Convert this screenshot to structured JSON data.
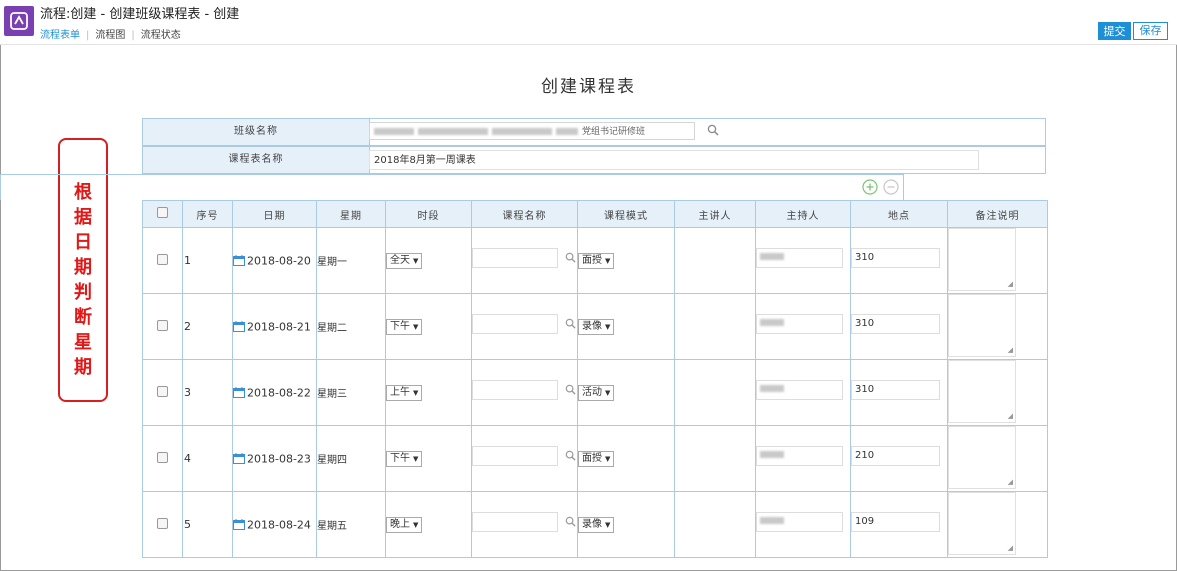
{
  "window_title": "流程:创建 - 创建班级课程表 - 创建",
  "tabs": [
    {
      "label": "流程表单",
      "active": true
    },
    {
      "label": "流程图",
      "active": false
    },
    {
      "label": "流程状态",
      "active": false
    }
  ],
  "actions": {
    "submit": "提交",
    "save": "保存"
  },
  "page_title": "创建课程表",
  "annotation": "根据日期判断星期",
  "form": {
    "class_name_label": "班级名称",
    "class_name_value": "党组书记研修班",
    "course_name_label": "课程表名称",
    "course_name_value": "2018年8月第一周课表"
  },
  "columns": [
    "",
    "序号",
    "日期",
    "星期",
    "时段",
    "课程名称",
    "课程模式",
    "主讲人",
    "主持人",
    "地点",
    "备注说明"
  ],
  "rows": [
    {
      "no": "1",
      "date": "2018-08-20",
      "weekday": "星期一",
      "period": "全天",
      "mode": "面授",
      "host": "",
      "place": "310"
    },
    {
      "no": "2",
      "date": "2018-08-21",
      "weekday": "星期二",
      "period": "下午",
      "mode": "录像",
      "host": "",
      "place": "310"
    },
    {
      "no": "3",
      "date": "2018-08-22",
      "weekday": "星期三",
      "period": "上午",
      "mode": "活动",
      "host": "",
      "place": "310"
    },
    {
      "no": "4",
      "date": "2018-08-23",
      "weekday": "星期四",
      "period": "下午",
      "mode": "面授",
      "host": "",
      "place": "210"
    },
    {
      "no": "5",
      "date": "2018-08-24",
      "weekday": "星期五",
      "period": "晚上",
      "mode": "录像",
      "host": "",
      "place": "109"
    }
  ],
  "colors": {
    "accent": "#1e8fd6",
    "header_bg": "#e6f0f9",
    "border": "#a9cbe6",
    "annotation": "#e01818",
    "app_icon": "#7a3fb0"
  },
  "icons": [
    "app-logo-icon",
    "search-icon",
    "calendar-icon",
    "add-circle-icon",
    "remove-circle-icon",
    "dropdown-arrow-icon"
  ]
}
